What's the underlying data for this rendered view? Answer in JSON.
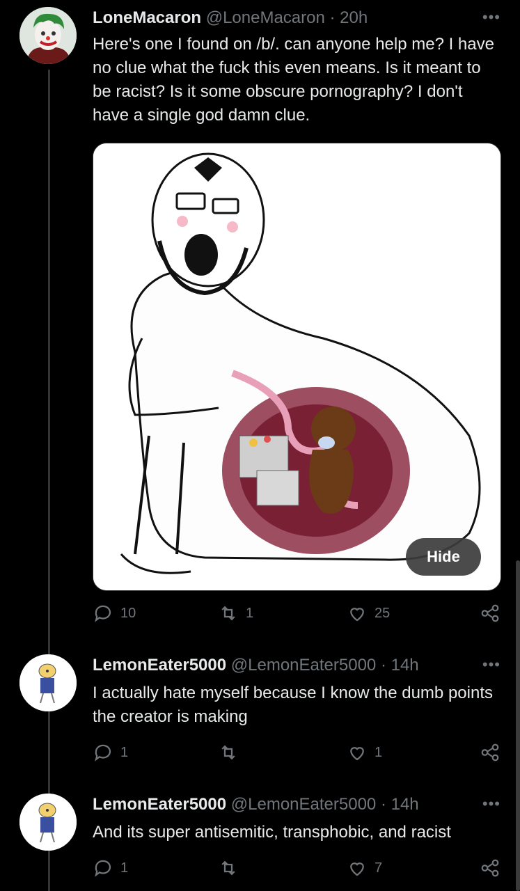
{
  "tweets": [
    {
      "name": "LoneMacaron",
      "handle": "@LoneMacaron",
      "time": "· 20h",
      "text": "Here's one I found on /b/. can anyone help me? I have no clue what the fuck this even means. Is it meant to be racist? Is it some obscure pornography? I don't have a single god damn clue.",
      "media": {
        "hide_label": "Hide"
      },
      "replies": "10",
      "retweets": "1",
      "likes": "25"
    },
    {
      "name": "LemonEater5000",
      "handle": "@LemonEater5000",
      "time": "· 14h",
      "text": "I actually hate myself because I know the dumb points the creator is making",
      "replies": "1",
      "retweets": "",
      "likes": "1"
    },
    {
      "name": "LemonEater5000",
      "handle": "@LemonEater5000",
      "time": "· 14h",
      "text": "And its super antisemitic, transphobic, and racist",
      "replies": "1",
      "retweets": "",
      "likes": "7"
    }
  ],
  "more_icon": "more-horizontal-icon",
  "colors": {
    "background": "#000000",
    "text": "#e7e9ea",
    "muted": "#71767b",
    "line": "#333639"
  }
}
